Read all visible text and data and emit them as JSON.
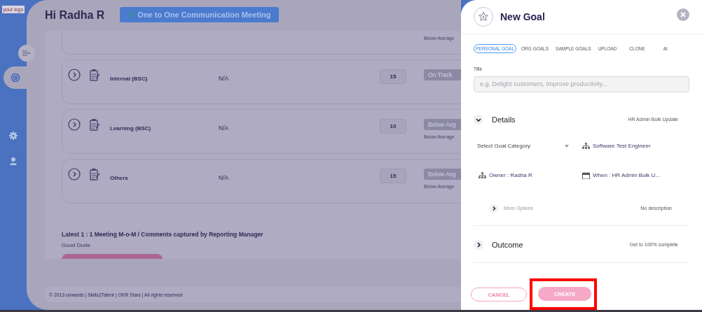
{
  "sidebar": {
    "logo": "your logo",
    "items": [
      {
        "kind": "toggle",
        "selected": false
      },
      {
        "kind": "goals",
        "selected": true
      },
      {
        "kind": "settings",
        "selected": false
      },
      {
        "kind": "profile",
        "selected": false
      }
    ]
  },
  "header": {
    "greeting": "Hi Radha R",
    "meeting_button": "One to One Communication Meeting"
  },
  "goal_cards": [
    {
      "status_note": "Below Average"
    },
    {
      "name": "Internal (BSC)",
      "owner": "N/A",
      "weight": "15",
      "status": "On Track"
    },
    {
      "name": "Learning (BSC)",
      "owner": "N/A",
      "weight": "10",
      "status": "Below Avg",
      "status_note": "Below Average"
    },
    {
      "name": "Others",
      "owner": "N/A",
      "weight": "15",
      "status": "Below Avg",
      "status_note": "Below Average"
    }
  ],
  "comments": {
    "heading": "Latest 1 : 1 Meeting M-o-M / Comments captured by Reporting Manager",
    "text": "Good Dude."
  },
  "footer": "© 2013 onwards | Skills2Talent | OKR Stars | All rights reserved",
  "drawer": {
    "title": "New Goal",
    "tabs": [
      {
        "label": "PERSONAL GOAL",
        "selected": true
      },
      {
        "label": "ORG GOALS",
        "selected": false
      },
      {
        "label": "SAMPLE GOALS",
        "selected": false
      },
      {
        "label": "UPLOAD",
        "selected": false
      },
      {
        "label": "CLONE",
        "selected": false
      },
      {
        "label": "AI",
        "selected": false
      }
    ],
    "title_field": {
      "label": "Title",
      "placeholder": "e.g. Delight customers, Improve productivity..."
    },
    "details": {
      "label": "Details",
      "expanded": true,
      "note": "HR Admin Bulk Update",
      "category_select": "Select Goal Category",
      "fields": [
        {
          "kind": "org",
          "text": "Software Test Engineer"
        },
        {
          "kind": "org",
          "text": "Owner : Radha R"
        },
        {
          "kind": "calendar",
          "text": "When : HR Admin Bulk U..."
        }
      ],
      "more_options": "More Options",
      "description": "No description"
    },
    "outcome": {
      "label": "Outcome",
      "expanded": false,
      "note": "Get to 100% complete"
    },
    "buttons": [
      {
        "label": "CANCEL",
        "kind": "outline",
        "highlighted": false
      },
      {
        "label": "CREATE",
        "kind": "filled",
        "highlighted": true
      }
    ]
  }
}
